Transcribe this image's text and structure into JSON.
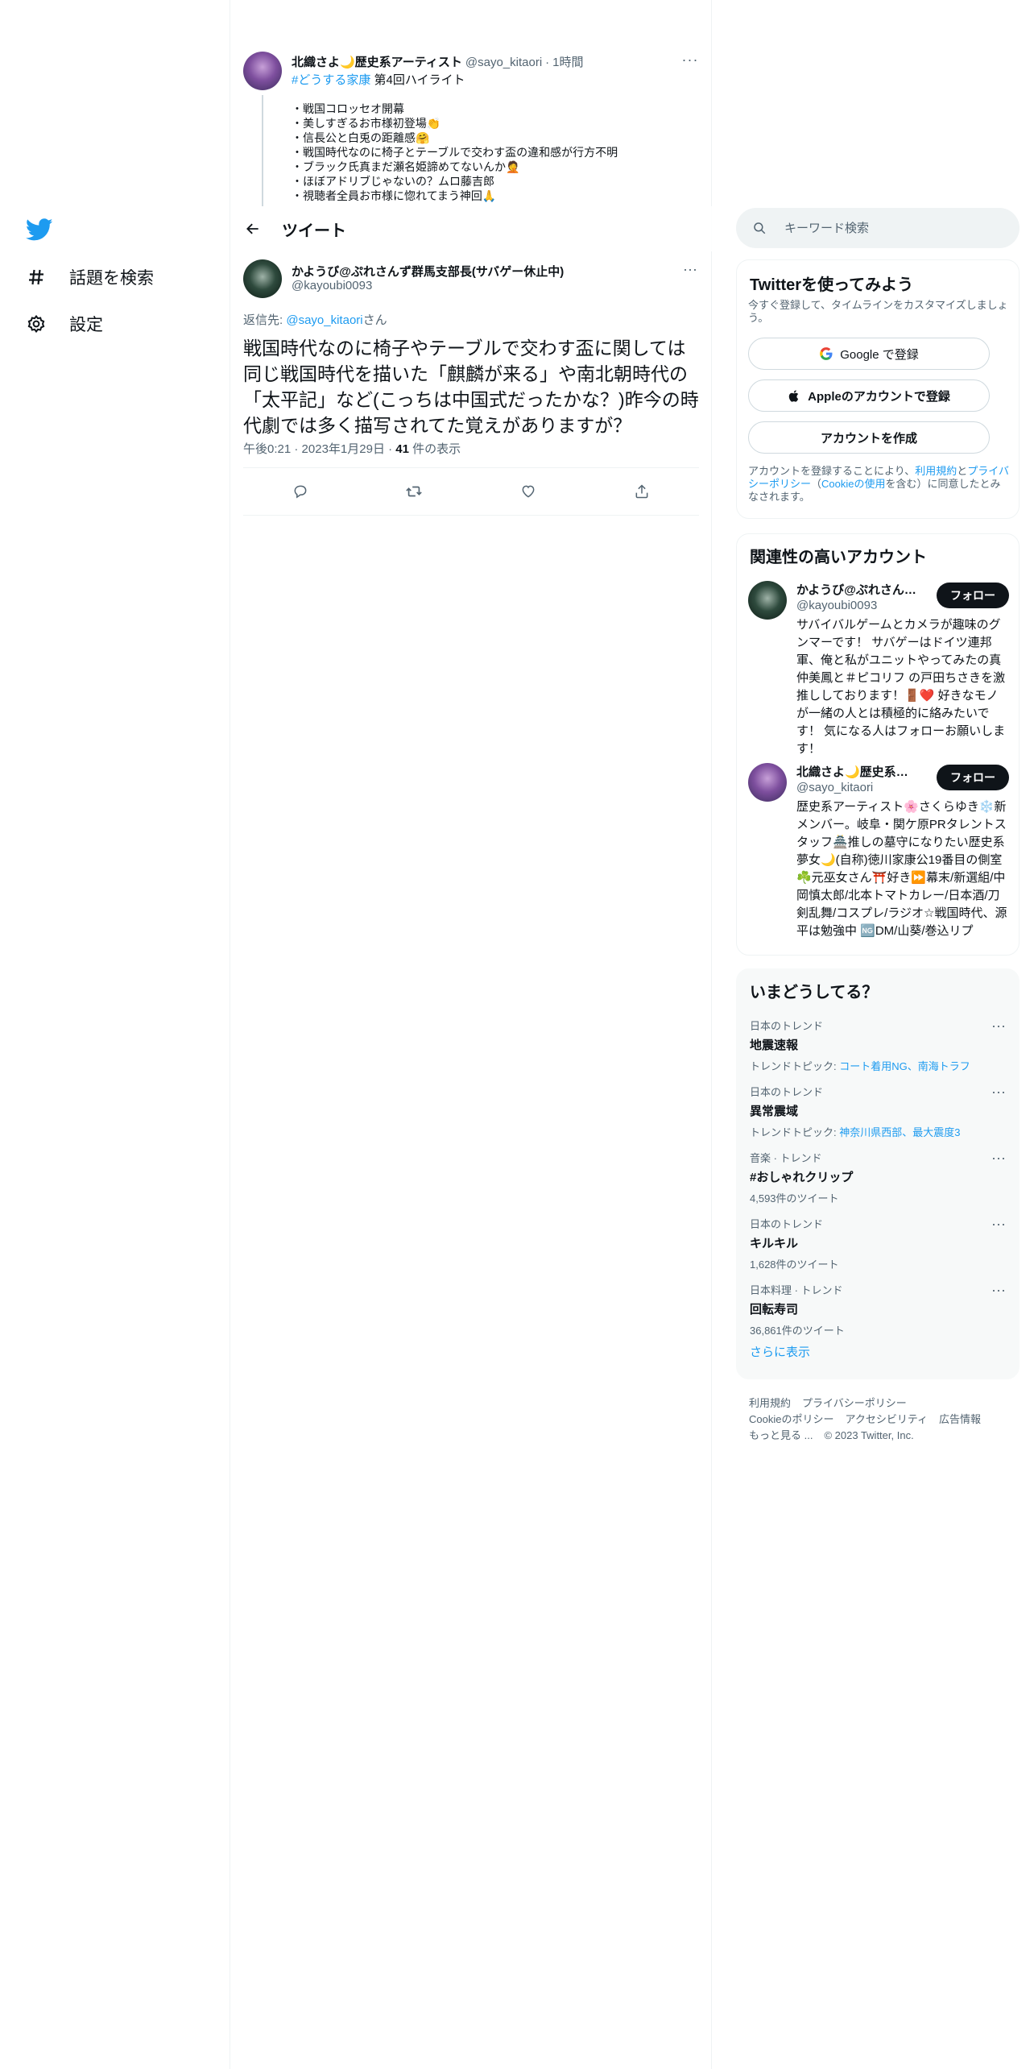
{
  "nav": {
    "logo_icon": "twitter-bird-icon",
    "items": [
      {
        "icon": "hashtag-icon",
        "label": "話題を検索"
      },
      {
        "icon": "gear-icon",
        "label": "設定"
      }
    ]
  },
  "parent_tweet": {
    "name": "北織さよ🌙歴史系アーティスト",
    "handle": "@sayo_kitaori",
    "dot": "·",
    "time": "1時間",
    "hashtag": "#どうする家康",
    "tag_rest": " 第4回ハイライト",
    "lines": [
      "・戦国コロッセオ開幕",
      "・美しすぎるお市様初登場👏",
      "・信長公と白兎の距離感🤗",
      "・戦国時代なのに椅子とテーブルで交わす盃の違和感が行方不明",
      "・ブラック氏真まだ瀬名姫諦めてないんか🤦",
      "・ほぼアドリブじゃないの？ムロ藤吉郎",
      "・視聴者全員お市様に惚れてまう神回🙏"
    ]
  },
  "topbar": {
    "title": "ツイート"
  },
  "tweet": {
    "name": "かようび@ぷれさんず群馬支部長(サバゲー休止中)",
    "handle": "@kayoubi0093",
    "reply_prefix": "返信先: ",
    "reply_mention": "@sayo_kitaori",
    "reply_suffix": "さん",
    "text": "戦国時代なのに椅子やテーブルで交わす盃に関しては同じ戦国時代を描いた「麒麟が来る」や南北朝時代の「太平記」など(こっちは中国式だったかな？)昨今の時代劇では多く描写されてた覚えがありますが？",
    "time": "午後0:21",
    "sep1": "·",
    "date": "2023年1月29日",
    "sep2": "·",
    "views": "41",
    "views_label": " 件の表示"
  },
  "search": {
    "placeholder": "キーワード検索"
  },
  "signup": {
    "title": "Twitterを使ってみよう",
    "desc": "今すぐ登録して、タイムラインをカスタマイズしましょう。",
    "google": "Google で登録",
    "apple": "Appleのアカウントで登録",
    "create": "アカウントを作成",
    "legal_1": "アカウントを登録することにより、",
    "terms": "利用規約",
    "legal_2": "と",
    "privacy": "プライバシーポリシー",
    "legal_3": "（",
    "cookie": "Cookieの使用",
    "legal_4": "を含む）に同意したとみなされます。"
  },
  "related": {
    "title": "関連性の高いアカウント",
    "follow_label": "フォロー",
    "accounts": [
      {
        "name": "かようび@ぷれさんず群馬支部長(サバゲー休止中)",
        "handle": "@kayoubi0093",
        "bio": "サバイバルゲームとカメラが趣味のグンマーです！ サバゲーはドイツ連邦軍、俺と私がユニットやってみたの真仲美鳳と＃ピコリフ の戸田ちさきを激推ししております！🚪❤️ 好きなモノが一緒の人とは積極的に絡みたいです！ 気になる人はフォローお願いします！"
      },
      {
        "name": "北織さよ🌙歴史系アーティスト",
        "handle": "@sayo_kitaori",
        "bio": "歴史系アーティスト🌸さくらゆき❄️新メンバー。岐阜・関ケ原PRタレントスタッフ🏯推しの墓守になりたい歴史系夢女🌙(自称)徳川家康公19番目の側室☘️元巫女さん⛩️好き⏩幕末/新選組/中岡慎太郎/北本トマトカレー/日本酒/刀剣乱舞/コスプレ/ラジオ☆戦国時代、源平は勉強中 🆖DM/山葵/巻込リプ"
      }
    ]
  },
  "trends": {
    "title": "いまどうしてる？",
    "items": [
      {
        "context": "日本のトレンド",
        "name": "地震速報",
        "sub_prefix": "トレンドトピック: ",
        "sub_links": "コート着用NG、南海トラフ",
        "sub_plain": ""
      },
      {
        "context": "日本のトレンド",
        "name": "異常震域",
        "sub_prefix": "トレンドトピック: ",
        "sub_links": "神奈川県西部、最大震度3",
        "sub_plain": ""
      },
      {
        "context": "音楽 · トレンド",
        "name": "#おしゃれクリップ",
        "sub_prefix": "",
        "sub_links": "",
        "sub_plain": "4,593件のツイート"
      },
      {
        "context": "日本のトレンド",
        "name": "キルキル",
        "sub_prefix": "",
        "sub_links": "",
        "sub_plain": "1,628件のツイート"
      },
      {
        "context": "日本料理 · トレンド",
        "name": "回転寿司",
        "sub_prefix": "",
        "sub_links": "",
        "sub_plain": "36,861件のツイート"
      }
    ],
    "show_more": "さらに表示"
  },
  "footer": {
    "terms": "利用規約",
    "privacy": "プライバシーポリシー",
    "cookie": "Cookieのポリシー",
    "accessibility": "アクセシビリティ",
    "ads": "広告情報",
    "more": "もっと見る ...",
    "copyright": "© 2023 Twitter, Inc."
  },
  "colors": {
    "accent": "#1d9bf0",
    "text": "#0f1419",
    "muted": "#536471",
    "border": "#eff3f4"
  }
}
